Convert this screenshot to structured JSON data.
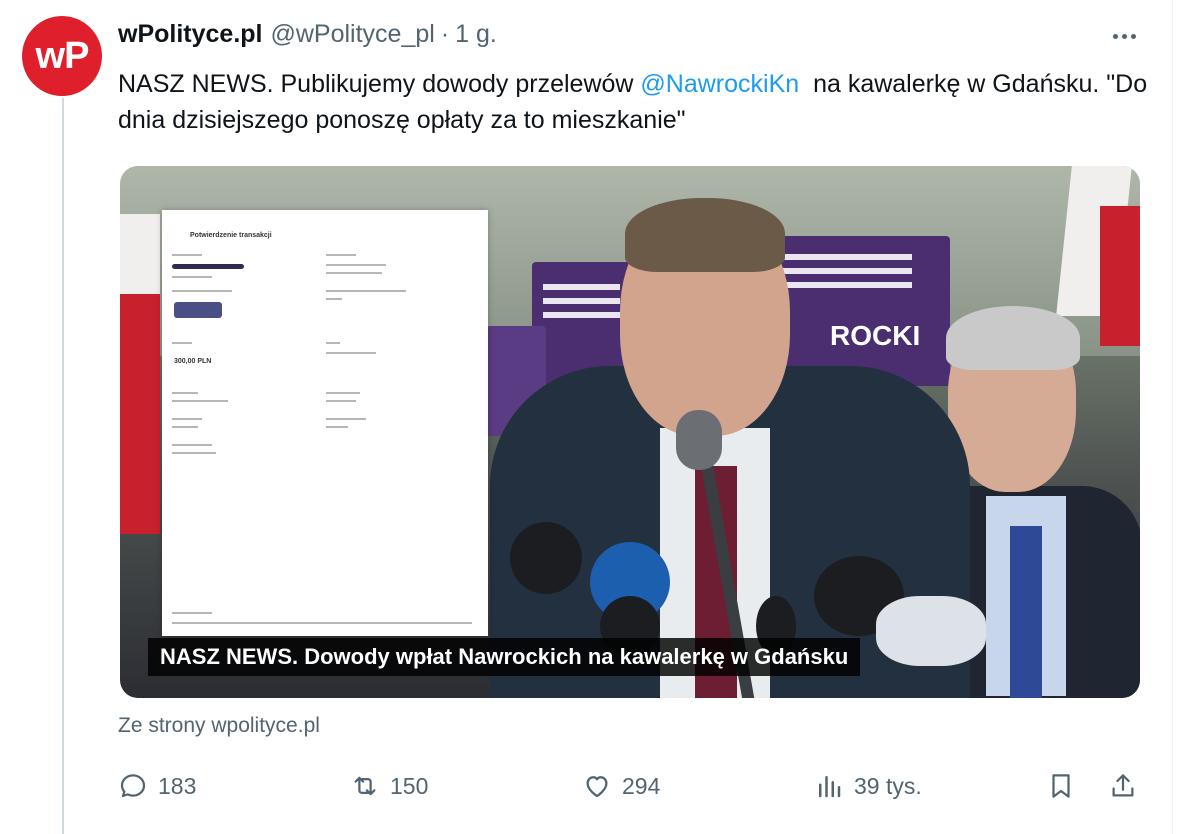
{
  "author": {
    "avatar_text": "wP",
    "name": "wPolityce.pl",
    "handle": "@wPolityce_pl",
    "separator": "·",
    "time": "1 g.",
    "avatar_color": "#e01f2d"
  },
  "tweet": {
    "text_part1": "NASZ NEWS. Publikujemy dowody przelewów ",
    "mention": "@NawrockiKn",
    "text_part2": "  na kawalerkę w Gdańsku. \"Do dnia dzisiejszego ponoszę opłaty za to mieszkanie\""
  },
  "media": {
    "caption": "NASZ NEWS. Dowody wpłat Nawrockich na kawalerkę w Gdańsku",
    "document": {
      "title": "Potwierdzenie transakcji",
      "amount": "300,00 PLN"
    },
    "sign_text": "ROCKI"
  },
  "link_source": "Ze strony wpolityce.pl",
  "actions": {
    "replies": "183",
    "reposts": "150",
    "likes": "294",
    "views": "39 tys."
  },
  "colors": {
    "accent": "#1d9bf0",
    "muted": "#536471",
    "text": "#0f1419"
  },
  "icons": [
    "more-icon",
    "reply-icon",
    "repost-icon",
    "like-icon",
    "views-icon",
    "bookmark-icon",
    "share-icon"
  ]
}
